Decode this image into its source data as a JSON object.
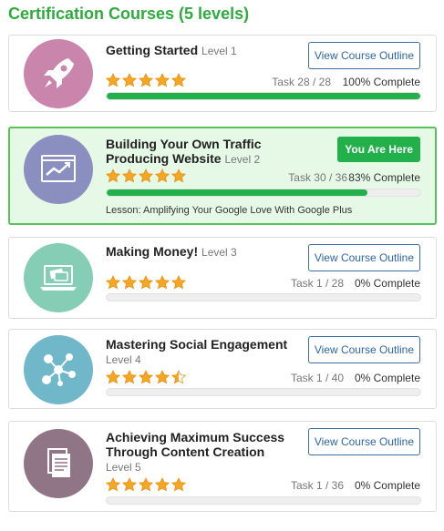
{
  "page_title": "Certification Courses (5 levels)",
  "colors": {
    "accent_green": "#22b04b",
    "link_blue": "#2f66a3",
    "current_bg": "#e6f8e6"
  },
  "courses": [
    {
      "title": "Getting Started",
      "level": "Level 1",
      "button": "View Course Outline",
      "rating": 5,
      "task": "Task 28 / 28",
      "complete": "100% Complete",
      "progress": 1.0,
      "icon": "rocket-icon",
      "badge_color": "#c985ab"
    },
    {
      "title_line1": "Building Your Own Traffic",
      "title_line2": "Producing Website",
      "level": "Level 2",
      "button": "You Are Here",
      "rating": 5,
      "task": "Task 30 / 36",
      "complete": "83% Complete",
      "progress": 0.83,
      "lesson": "Lesson: Amplifying Your Google Love With Google Plus",
      "icon": "growth-chart-icon",
      "badge_color": "#8a8fc0"
    },
    {
      "title": "Making Money!",
      "level": "Level 3",
      "button": "View Course Outline",
      "rating": 5,
      "task": "Task 1 / 28",
      "complete": "0% Complete",
      "progress": 0,
      "icon": "laptop-payment-icon",
      "badge_color": "#86cdb5"
    },
    {
      "title": "Mastering Social Engagement",
      "level": "Level 4",
      "button": "View Course Outline",
      "rating": 4.5,
      "task": "Task 1 / 40",
      "complete": "0% Complete",
      "progress": 0,
      "icon": "social-network-icon",
      "badge_color": "#6fb7c9"
    },
    {
      "title_line1": "Achieving Maximum Success",
      "title_line2": "Through Content Creation",
      "level": "Level 5",
      "button": "View Course Outline",
      "rating": 5,
      "task": "Task 1 / 36",
      "complete": "0% Complete",
      "progress": 0,
      "icon": "documents-icon",
      "badge_color": "#8f7585"
    }
  ]
}
